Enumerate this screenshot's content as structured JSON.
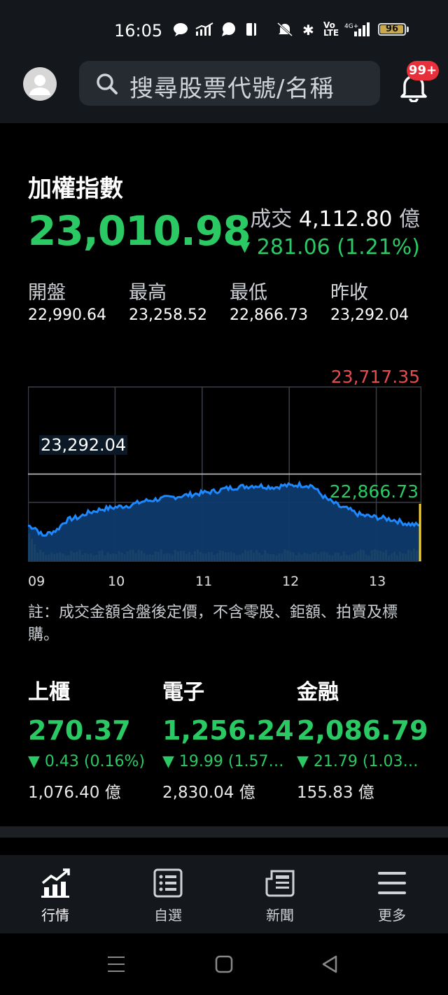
{
  "status_bar": {
    "time": "16:05",
    "battery": "96",
    "battery_level": 0.96
  },
  "header": {
    "search_placeholder": "搜尋股票代號/名稱",
    "notification_badge": "99+"
  },
  "index": {
    "title": "加權指數",
    "value": "23,010.98",
    "volume_label": "成交",
    "volume_value": "4,112.80",
    "volume_unit": "億",
    "change_arrow": "▼",
    "change": "281.06 (1.21%)",
    "stats": [
      {
        "label": "開盤",
        "value": "22,990.64"
      },
      {
        "label": "最高",
        "value": "23,258.52"
      },
      {
        "label": "最低",
        "value": "22,866.73"
      },
      {
        "label": "昨收",
        "value": "23,292.04"
      }
    ]
  },
  "chart_data": {
    "type": "area",
    "max_label": "23,717.35",
    "prev_close_label": "23,292.04",
    "low_label": "22,866.73",
    "ylim": [
      22866.73,
      23717.35
    ],
    "prev_close": 23292.04,
    "x_ticks": [
      "09",
      "10",
      "11",
      "12",
      "13"
    ],
    "series": [
      {
        "values": [
          23040,
          23030,
          22990,
          23005,
          23020,
          23060,
          23075,
          23080,
          23100,
          23110,
          23120,
          23125,
          23130,
          23135,
          23140,
          23150,
          23160,
          23165,
          23170,
          23175,
          23180,
          23185,
          23190,
          23195,
          23200,
          23205,
          23210,
          23220,
          23225,
          23230,
          23232,
          23236,
          23234,
          23230,
          23228,
          23236,
          23235,
          23240,
          23238,
          23236,
          23200,
          23170,
          23150,
          23130,
          23120,
          23100,
          23090,
          23085,
          23080,
          23075,
          23070,
          23060,
          23050,
          23045,
          23040
        ]
      }
    ]
  },
  "note": "註：成交金額含盤後定價，不含零股、鉅額、拍賣及標購。",
  "sub_indices": [
    {
      "name": "上櫃",
      "value": "270.37",
      "change": "▼ 0.43 (0.16%)",
      "volume": "1,076.40 億"
    },
    {
      "name": "電子",
      "value": "1,256.24",
      "change": "▼ 19.99 (1.57…",
      "volume": "2,830.04 億"
    },
    {
      "name": "金融",
      "value": "2,086.79",
      "change": "▼ 21.79 (1.03…",
      "volume": "155.83 億"
    }
  ],
  "bottom_nav": [
    {
      "label": "行情",
      "icon": "market-chart-icon"
    },
    {
      "label": "自選",
      "icon": "watchlist-icon"
    },
    {
      "label": "新聞",
      "icon": "news-icon"
    },
    {
      "label": "更多",
      "icon": "menu-icon"
    }
  ],
  "colors": {
    "up": "#e74b4b",
    "down": "#2bc964",
    "line": "#1e88ff",
    "volume": "#f2cf2c"
  }
}
